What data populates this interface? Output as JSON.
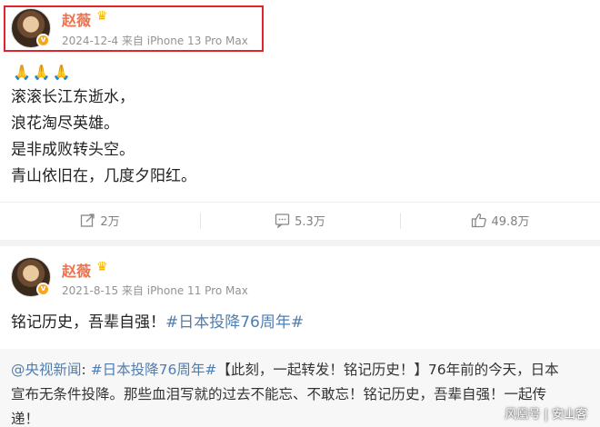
{
  "post1": {
    "username": "赵薇",
    "meta": "2024-12-4 来自 iPhone 13 Pro Max",
    "lines": [
      "滚滚长江东逝水，",
      "浪花淘尽英雄。",
      "是非成败转头空。",
      "青山依旧在，几度夕阳红。"
    ],
    "actions": {
      "repost": "2万",
      "comment": "5.3万",
      "like": "49.8万"
    }
  },
  "post2": {
    "username": "赵薇",
    "meta": "2021-8-15 来自 iPhone 11 Pro Max",
    "text_plain": "铭记历史，吾辈自强！",
    "text_tag": "#日本投降76周年#",
    "repost": {
      "source": "@央视新闻",
      "colon": ":",
      "tag": "#日本投降76周年#",
      "line1_rest": "【此刻，一起转发！铭记历史！】76年前的今天，日本",
      "line2": "宣布无条件投降。那些血泪写就的过去不能忘、不敢忘！铭记历史，吾辈自强！一起传",
      "line3": "递！"
    }
  },
  "watermark": "风凰号 | 安山客",
  "colors": {
    "username": "#eb7350",
    "tag": "#507daf",
    "highlight": "#e0242b"
  }
}
